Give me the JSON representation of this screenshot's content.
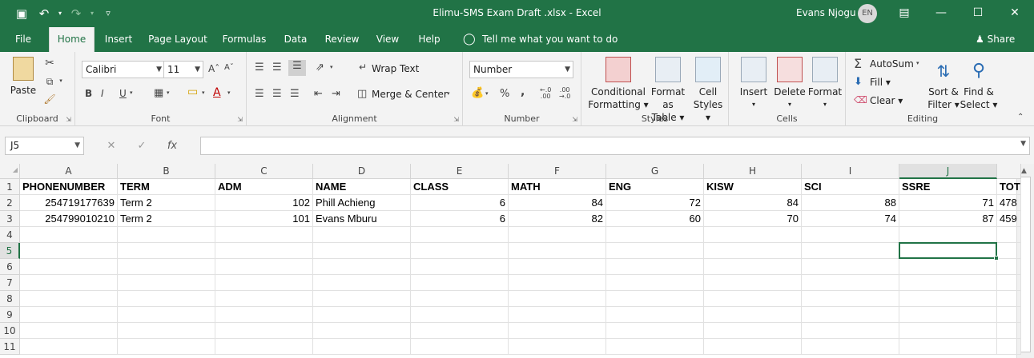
{
  "titlebar": {
    "title": "Elimu-SMS Exam Draft .xlsx  -  Excel",
    "user": "Evans Njogu",
    "user_initials": "EN",
    "qat": {
      "save_icon": "🖫",
      "undo_icon": "↶",
      "redo_icon": "↷",
      "customize_icon": "▿"
    },
    "window": {
      "restore_icon": "⧉",
      "min_icon": "—",
      "max_icon": "☐",
      "close_icon": "✕"
    }
  },
  "tabs": [
    {
      "label": "File"
    },
    {
      "label": "Home"
    },
    {
      "label": "Insert"
    },
    {
      "label": "Page Layout"
    },
    {
      "label": "Formulas"
    },
    {
      "label": "Data"
    },
    {
      "label": "Review"
    },
    {
      "label": "View"
    },
    {
      "label": "Help"
    }
  ],
  "tell_me": "Tell me what you want to do",
  "share": "Share",
  "ribbon": {
    "clipboard": {
      "label": "Clipboard",
      "paste": "Paste"
    },
    "font": {
      "label": "Font",
      "font_name": "Calibri",
      "font_size": "11",
      "bold": "B",
      "italic": "I",
      "underline": "U"
    },
    "alignment": {
      "label": "Alignment",
      "wrap_text": "Wrap Text",
      "merge_center": "Merge & Center"
    },
    "number": {
      "label": "Number",
      "format": "Number",
      "percent": "%",
      "comma": ",",
      "inc_decimal": "←.0\n.00",
      "dec_decimal": ".00\n→.0"
    },
    "styles": {
      "label": "Styles",
      "conditional_1": "Conditional",
      "conditional_2": "Formatting",
      "format_table_1": "Format as",
      "format_table_2": "Table",
      "cell_styles_1": "Cell",
      "cell_styles_2": "Styles"
    },
    "cells": {
      "label": "Cells",
      "insert": "Insert",
      "delete": "Delete",
      "format": "Format"
    },
    "editing": {
      "label": "Editing",
      "autosum": "AutoSum",
      "fill": "Fill",
      "clear": "Clear",
      "sort_1": "Sort &",
      "sort_2": "Filter",
      "find_1": "Find &",
      "find_2": "Select"
    }
  },
  "formula_bar": {
    "name_box": "J5",
    "cancel": "✕",
    "enter": "✓",
    "fx": "fx",
    "value": ""
  },
  "sheet": {
    "columns": [
      "A",
      "B",
      "C",
      "D",
      "E",
      "F",
      "G",
      "H",
      "I",
      "J"
    ],
    "rows": [
      "1",
      "2",
      "3",
      "4",
      "5",
      "6",
      "7",
      "8",
      "9",
      "10",
      "11"
    ],
    "selected_cell": "J5",
    "header_row": [
      "PHONENUMBER",
      "TERM",
      "ADM",
      "NAME",
      "CLASS",
      "MATH",
      "ENG",
      "KISW",
      "SCI",
      "SSRE",
      "TOT"
    ],
    "data": [
      [
        "254719177639",
        "Term 2",
        "102",
        "Phill Achieng",
        "6",
        "84",
        "72",
        "84",
        "88",
        "71",
        "478"
      ],
      [
        "254799010210",
        "Term 2",
        "101",
        "Evans Mburu",
        "6",
        "82",
        "60",
        "70",
        "74",
        "87",
        "459"
      ]
    ]
  },
  "colors": {
    "accent": "#217346",
    "ribbon_bg": "#f3f3f3",
    "grid_line": "#e1e1e1"
  }
}
